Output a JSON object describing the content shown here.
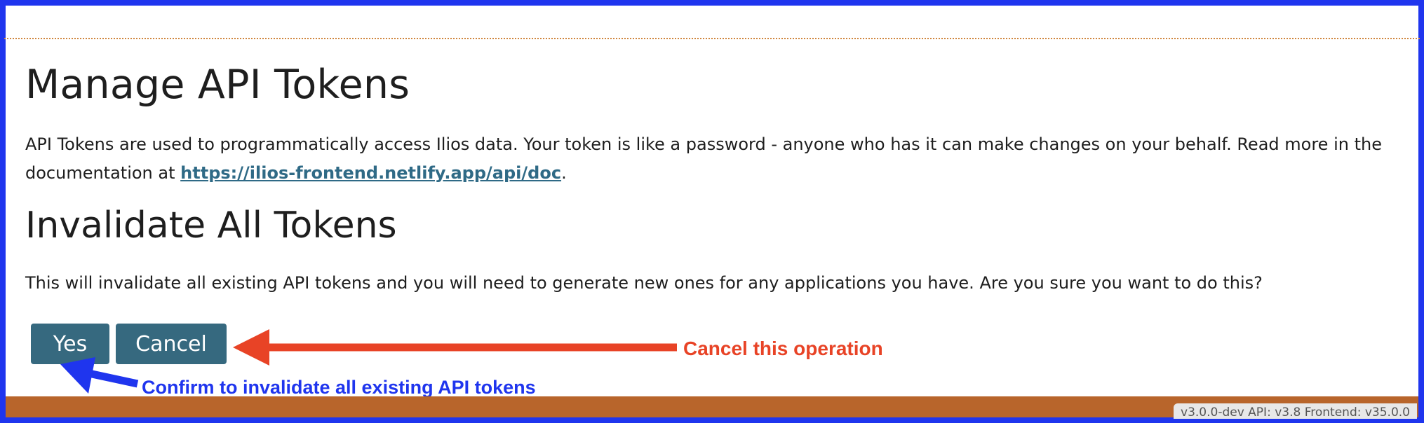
{
  "header": {
    "title": "Manage API Tokens"
  },
  "intro": {
    "text": "API Tokens are used to programmatically access Ilios data. Your token is like a password - anyone who has it can make changes on your behalf. Read more in the documentation at ",
    "link_text": "https://ilios-frontend.netlify.app/api/doc",
    "end": "."
  },
  "invalidate": {
    "title": "Invalidate All Tokens",
    "warning": "This will invalidate all existing API tokens and you will need to generate new ones for any applications you have. Are you sure you want to do this?",
    "yes_label": "Yes",
    "cancel_label": "Cancel"
  },
  "annotations": {
    "cancel_note": "Cancel this operation",
    "yes_note": "Confirm to invalidate all existing API tokens",
    "cancel_color": "#e84326",
    "yes_color": "#1f35ee"
  },
  "footer": {
    "version": "v3.0.0-dev API: v3.8 Frontend: v35.0.0"
  },
  "colors": {
    "frame": "#1f35ee",
    "button": "#36697f",
    "footer": "#b8652b",
    "link": "#2f6a86"
  }
}
